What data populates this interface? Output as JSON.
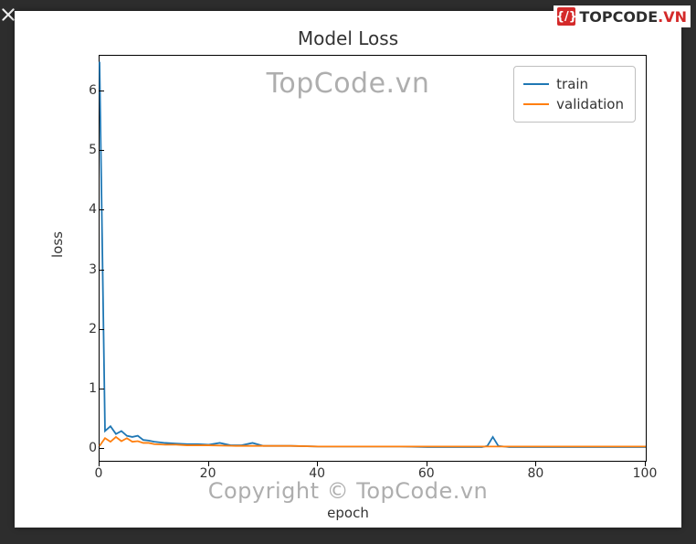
{
  "chart_data": {
    "type": "line",
    "title": "Model Loss",
    "xlabel": "epoch",
    "ylabel": "loss",
    "xlim": [
      0,
      100
    ],
    "ylim": [
      -0.2,
      6.6
    ],
    "xticks": [
      0,
      20,
      40,
      60,
      80,
      100
    ],
    "yticks": [
      0,
      1,
      2,
      3,
      4,
      5,
      6
    ],
    "legend_position": "upper right",
    "series": [
      {
        "name": "train",
        "color": "#1f77b4",
        "x": [
          0,
          1,
          2,
          3,
          4,
          5,
          6,
          7,
          8,
          9,
          10,
          12,
          14,
          16,
          18,
          20,
          22,
          24,
          26,
          28,
          30,
          32,
          35,
          40,
          45,
          50,
          55,
          60,
          65,
          70,
          71,
          72,
          73,
          75,
          80,
          85,
          90,
          95,
          100
        ],
        "y": [
          6.5,
          0.3,
          0.38,
          0.25,
          0.3,
          0.22,
          0.2,
          0.22,
          0.15,
          0.14,
          0.12,
          0.1,
          0.09,
          0.08,
          0.08,
          0.07,
          0.1,
          0.06,
          0.06,
          0.1,
          0.05,
          0.05,
          0.05,
          0.04,
          0.04,
          0.04,
          0.04,
          0.03,
          0.03,
          0.03,
          0.05,
          0.2,
          0.05,
          0.03,
          0.03,
          0.03,
          0.03,
          0.03,
          0.03
        ]
      },
      {
        "name": "validation",
        "color": "#ff7f0e",
        "x": [
          0,
          1,
          2,
          3,
          4,
          5,
          6,
          7,
          8,
          9,
          10,
          12,
          14,
          16,
          18,
          20,
          25,
          30,
          35,
          40,
          45,
          50,
          55,
          60,
          65,
          70,
          75,
          80,
          85,
          90,
          95,
          100
        ],
        "y": [
          0.05,
          0.18,
          0.12,
          0.2,
          0.13,
          0.18,
          0.12,
          0.13,
          0.1,
          0.1,
          0.08,
          0.07,
          0.07,
          0.06,
          0.06,
          0.06,
          0.05,
          0.05,
          0.05,
          0.04,
          0.04,
          0.04,
          0.04,
          0.04,
          0.04,
          0.04,
          0.04,
          0.04,
          0.04,
          0.04,
          0.04,
          0.04
        ]
      }
    ]
  },
  "overlays": {
    "watermark_main": "TopCode.vn",
    "watermark_copy": "Copyright © TopCode.vn",
    "badge_icon_text": "{/}",
    "badge_text_main": "TOPCODE",
    "badge_text_suffix": ".VN"
  }
}
